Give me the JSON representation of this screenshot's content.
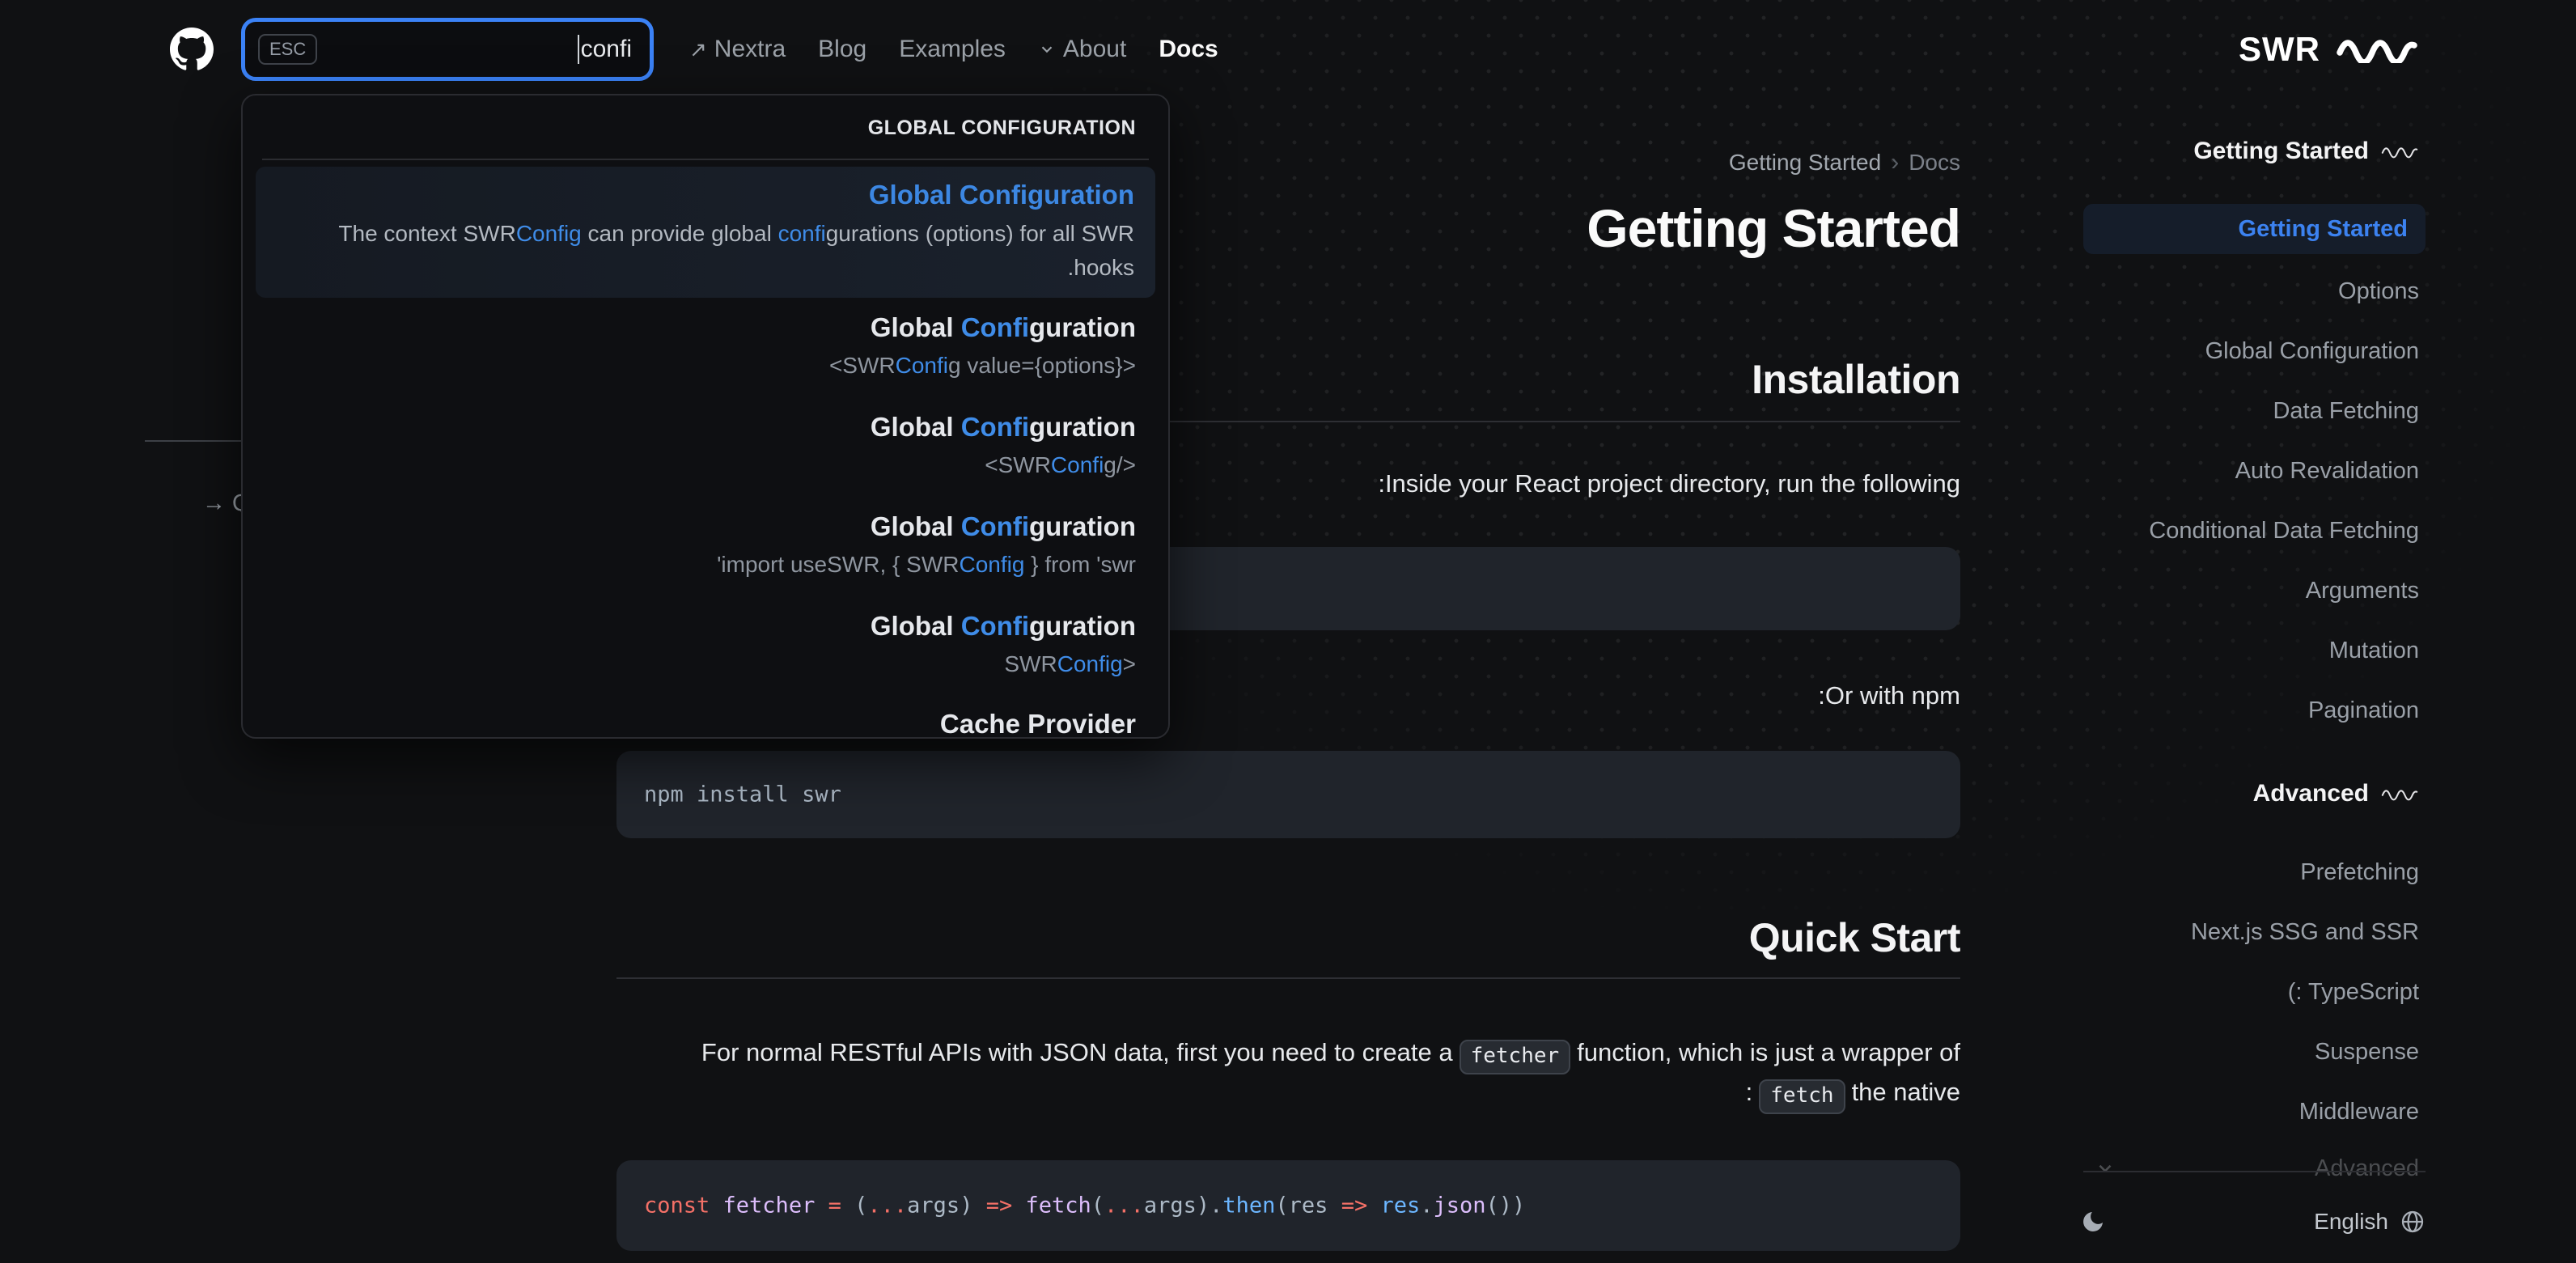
{
  "colors": {
    "accent_blue": "#3b82f6",
    "search_highlight": "#3f8ce8",
    "code_red": "#f47067",
    "code_purple": "#dcbdfb",
    "code_blue": "#6cb6ff"
  },
  "header": {
    "logo": "SWR",
    "search": {
      "esc": "ESC",
      "query": "confi"
    },
    "nav": [
      {
        "label": "Nextra"
      },
      {
        "label": "Blog"
      },
      {
        "label": "Examples"
      },
      {
        "label": "About"
      },
      {
        "label": "Docs"
      }
    ]
  },
  "search_dropdown": {
    "group": "GLOBAL CONFIGURATION",
    "results": [
      {
        "title": "Global Configuration",
        "d1": "The context SWR",
        "d2": "Config",
        "d3": " can provide global ",
        "d4": "confi",
        "d5": "gurations (options) for all SWR",
        "d6": ".hooks"
      },
      {
        "tp": "Global ",
        "tm": "Confi",
        "ts": "guration",
        "sp": "<SWR",
        "sm": "Confi",
        "ss": "g value={options}>"
      },
      {
        "tp": "Global ",
        "tm": "Confi",
        "ts": "guration",
        "sp": "<SWR",
        "sm": "Confi",
        "ss": "g/>"
      },
      {
        "tp": "Global ",
        "tm": "Confi",
        "ts": "guration",
        "sp": "'import useSWR, { SWR",
        "sm": "Config",
        "ss": " } from 'swr"
      },
      {
        "tp": "Global ",
        "tm": "Confi",
        "ts": "guration",
        "sp": "SWR",
        "sm": "Config",
        "ss": ">"
      }
    ],
    "next_group_title": "Cache Provider"
  },
  "toc": {
    "fragment": "→ Quick Start"
  },
  "main": {
    "breadcrumb": {
      "parent": "Getting Started",
      "sep": "›",
      "current": "Docs"
    },
    "title": "Getting Started",
    "installation": {
      "heading": "Installation",
      "p1": ":Inside your React project directory, run the following",
      "p2": ":Or with npm",
      "code_npm": "npm install swr"
    },
    "quick_start": {
      "heading": "Quick Start",
      "p_before": "For normal RESTful APIs with JSON data, first you need to create a",
      "chip1": "fetcher",
      "p_after": "function, which is just a wrapper of",
      "p2_prefix": ":",
      "chip2": "fetch",
      "p2_suffix": "the native"
    },
    "code_fetcher": {
      "tokens": [
        {
          "t": "const"
        },
        {
          "t": " fetcher"
        },
        {
          "t": " "
        },
        {
          "t": "="
        },
        {
          "t": " ("
        },
        {
          "t": "..."
        },
        {
          "t": "args"
        },
        {
          "t": ") "
        },
        {
          "t": "=>"
        },
        {
          "t": " fetch"
        },
        {
          "t": "("
        },
        {
          "t": "..."
        },
        {
          "t": "args"
        },
        {
          "t": ")."
        },
        {
          "t": "then"
        },
        {
          "t": "("
        },
        {
          "t": "res "
        },
        {
          "t": "=>"
        },
        {
          "t": " res"
        },
        {
          "t": "."
        },
        {
          "t": "json"
        },
        {
          "t": "())"
        }
      ]
    }
  },
  "sidebar": {
    "sections": [
      {
        "title": "Getting Started",
        "items": [
          "Getting Started",
          "Options",
          "Global Configuration",
          "Data Fetching",
          "Auto Revalidation",
          "Conditional Data Fetching",
          "Arguments",
          "Mutation",
          "Pagination"
        ]
      },
      {
        "title": "Advanced",
        "items": [
          "Prefetching",
          "Next.js SSG and SSR",
          "(: TypeScript",
          "Suspense",
          "Middleware"
        ]
      }
    ],
    "collapsed_item": "Advanced",
    "footer": {
      "language": "English"
    }
  }
}
